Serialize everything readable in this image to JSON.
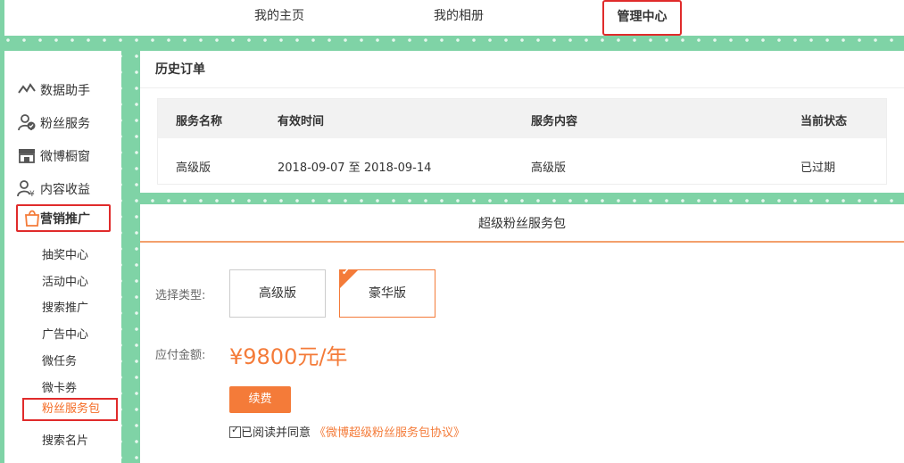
{
  "topnav": {
    "home": "我的主页",
    "album": "我的相册",
    "admin": "管理中心"
  },
  "sidebar": {
    "items": [
      {
        "label": "数据助手",
        "icon": "chart-line-icon"
      },
      {
        "label": "粉丝服务",
        "icon": "fans-service-icon"
      },
      {
        "label": "微博橱窗",
        "icon": "storefront-icon"
      },
      {
        "label": "内容收益",
        "icon": "income-icon"
      },
      {
        "label": "营销推广",
        "icon": "shopping-bag-icon"
      }
    ],
    "subitems": [
      "抽奖中心",
      "活动中心",
      "搜索推广",
      "广告中心",
      "微任务",
      "微卡券",
      "粉丝服务包",
      "搜索名片"
    ]
  },
  "history": {
    "title": "历史订单",
    "columns": [
      "服务名称",
      "有效时间",
      "服务内容",
      "当前状态"
    ],
    "rows": [
      [
        "高级版",
        "2018-09-07 至 2018-09-14",
        "高级版",
        "已过期"
      ]
    ]
  },
  "package": {
    "title": "超级粉丝服务包",
    "type_label": "选择类型:",
    "types": [
      "高级版",
      "豪华版"
    ],
    "selected_type": "豪华版",
    "amount_label": "应付金额:",
    "price": "¥9800元/年",
    "renew_button": "续费",
    "agree_text": "已阅读并同意",
    "agreement_link": "《微博超级粉丝服务包协议》",
    "agreed": true
  },
  "colors": {
    "accent": "#f47b39",
    "highlight_border": "#e02b2b",
    "background": "#7fd3a6"
  }
}
